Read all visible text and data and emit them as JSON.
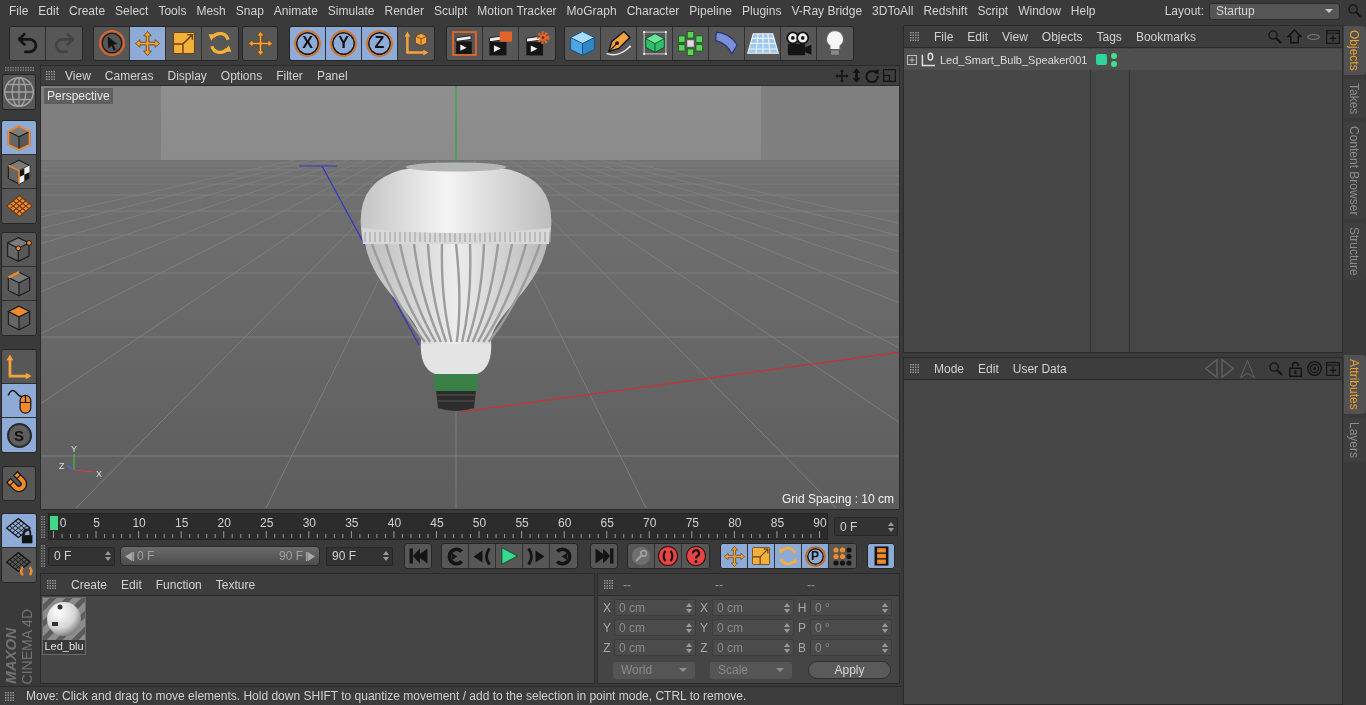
{
  "menu_bar": {
    "items": [
      "File",
      "Edit",
      "Create",
      "Select",
      "Tools",
      "Mesh",
      "Snap",
      "Animate",
      "Simulate",
      "Render",
      "Sculpt",
      "Motion Tracker",
      "MoGraph",
      "Character",
      "Pipeline",
      "Plugins",
      "V-Ray Bridge",
      "3DToAll",
      "Redshift",
      "Script",
      "Window",
      "Help"
    ],
    "layout_label": "Layout:",
    "layout_value": "Startup"
  },
  "toolbar": {
    "history": [
      {
        "disabled": false
      },
      {
        "disabled": true
      }
    ],
    "tools": [
      {
        "on": false
      },
      {
        "on": true
      },
      {
        "on": false
      },
      {
        "on": false
      },
      {
        "on": false
      }
    ],
    "axes": [
      {
        "label": "X",
        "on": true
      },
      {
        "label": "Y",
        "on": true
      },
      {
        "label": "Z",
        "on": true
      }
    ]
  },
  "left_toolbar": [
    {
      "on": true
    },
    {
      "on": false
    },
    {
      "on": false
    },
    {
      "on": false
    },
    {
      "on": false
    },
    {
      "on": false
    },
    {
      "on": false
    },
    {
      "on": true
    },
    {
      "label": "S",
      "on": true
    },
    {
      "on": false
    },
    {
      "on": true
    },
    {
      "on": false
    }
  ],
  "logo": {
    "brand": "MAXON",
    "product": "CINEMA 4D"
  },
  "viewport": {
    "menu": [
      "View",
      "Cameras",
      "Display",
      "Options",
      "Filter",
      "Panel"
    ],
    "camera": "Perspective",
    "grid_spacing": "Grid Spacing : 10 cm",
    "axis_labels": [
      "Y",
      "Z",
      "X"
    ]
  },
  "timeline": {
    "ticks": [
      "0",
      "5",
      "10",
      "15",
      "20",
      "25",
      "30",
      "35",
      "40",
      "45",
      "50",
      "55",
      "60",
      "65",
      "70",
      "75",
      "80",
      "85",
      "90"
    ],
    "level": 0,
    "current_frame": "0 F"
  },
  "transport": {
    "start_field": "0 F",
    "range": {
      "start": "0 F",
      "end": "90 F",
      "level": 1
    },
    "end_field": "90 F"
  },
  "animation_tools": [
    {
      "on": true
    },
    {
      "on": true
    },
    {
      "on": true
    },
    {
      "label": "P",
      "on": true
    },
    {
      "on": false
    }
  ],
  "timeline_toggle": {
    "on": true
  },
  "material_manager": {
    "menu": [
      "Create",
      "Edit",
      "Function",
      "Texture"
    ],
    "materials": [
      {
        "name": "Led_blu"
      }
    ]
  },
  "coordinates": {
    "headers": [
      "--",
      "--",
      "--"
    ],
    "rows": [
      {
        "cells": [
          {
            "axis": "X",
            "value": "0 cm"
          },
          {
            "axis": "X",
            "value": "0 cm"
          },
          {
            "axis": "H",
            "value": "0 °"
          }
        ]
      },
      {
        "cells": [
          {
            "axis": "Y",
            "value": "0 cm"
          },
          {
            "axis": "Y",
            "value": "0 cm"
          },
          {
            "axis": "P",
            "value": "0 °"
          }
        ]
      },
      {
        "cells": [
          {
            "axis": "Z",
            "value": "0 cm"
          },
          {
            "axis": "Z",
            "value": "0 cm"
          },
          {
            "axis": "B",
            "value": "0 °"
          }
        ]
      }
    ],
    "space": "World",
    "mode": "Scale",
    "apply": "Apply"
  },
  "status_bar": "Move: Click and drag to move elements. Hold down SHIFT to quantize movement / add to the selection in point mode, CTRL to remove.",
  "object_manager": {
    "menu": [
      "File",
      "Edit",
      "View",
      "Objects",
      "Tags",
      "Bookmarks"
    ],
    "objects": [
      {
        "name": "Led_Smart_Bulb_Speaker001",
        "expanded": false,
        "color": "#2ed69b",
        "editor_visible": true,
        "render_visible": true
      }
    ]
  },
  "attribute_manager": {
    "menu": [
      "Mode",
      "Edit",
      "User Data"
    ]
  },
  "side_tabs": {
    "upper": [
      {
        "label": "Objects",
        "selected": true
      },
      {
        "label": "Takes",
        "selected": false
      },
      {
        "label": "Content Browser",
        "selected": false
      },
      {
        "label": "Structure",
        "selected": false
      }
    ],
    "lower": [
      {
        "label": "Attributes",
        "selected": true
      },
      {
        "label": "Layers",
        "selected": false
      }
    ]
  }
}
